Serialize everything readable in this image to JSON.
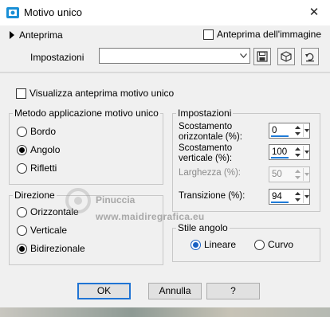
{
  "window": {
    "title": "Motivo unico",
    "close_glyph": "✕",
    "icon": "app-icon"
  },
  "top": {
    "preview_label": "Anteprima",
    "preview_image_label": "Anteprima dell'immagine",
    "preview_image_checked": false,
    "settings_label": "Impostazioni",
    "settings_value": ""
  },
  "main": {
    "visualize_label": "Visualizza anteprima motivo unico",
    "visualize_checked": false,
    "method": {
      "legend": "Metodo applicazione motivo unico",
      "options": [
        "Bordo",
        "Angolo",
        "Rifletti"
      ],
      "selected": "Angolo"
    },
    "direction": {
      "legend": "Direzione",
      "options": [
        "Orizzontale",
        "Verticale",
        "Bidirezionale"
      ],
      "selected": "Bidirezionale"
    },
    "settings": {
      "legend": "Impostazioni",
      "params": [
        {
          "label_line1": "Scostamento",
          "label_line2": "orizzontale (%):",
          "value": "0",
          "enabled": true
        },
        {
          "label_line1": "Scostamento",
          "label_line2": "verticale (%):",
          "value": "100",
          "enabled": true
        },
        {
          "label_line1": "Larghezza (%):",
          "label_line2": "",
          "value": "50",
          "enabled": false
        },
        {
          "label_line1": "Transizione (%):",
          "label_line2": "",
          "value": "94",
          "enabled": true
        }
      ]
    },
    "corner": {
      "legend": "Stile angolo",
      "options": [
        "Lineare",
        "Curvo"
      ],
      "selected": "Lineare"
    },
    "watermark": {
      "name": "Pinuccia",
      "url": "www.maidiregrafica.eu"
    }
  },
  "buttons": {
    "ok": "OK",
    "cancel": "Annulla",
    "help": "?"
  },
  "colors": {
    "accent": "#1e7bd8",
    "ok_border": "#2074d4",
    "dialog_bg": "#f0f0f0"
  }
}
